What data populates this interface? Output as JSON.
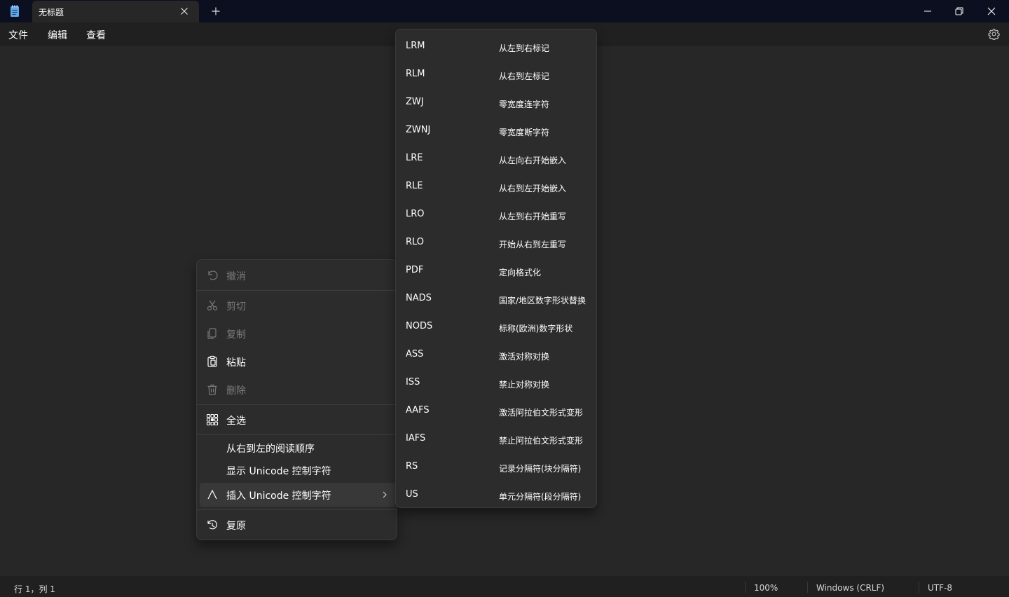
{
  "window": {
    "tab_title": "无标题"
  },
  "menubar": {
    "file": "文件",
    "edit": "编辑",
    "view": "查看"
  },
  "context_menu": {
    "undo": "撤消",
    "cut": "剪切",
    "copy": "复制",
    "paste": "粘贴",
    "delete": "删除",
    "select_all": "全选",
    "rtl_reading": "从右到左的阅读顺序",
    "show_unicode": "显示 Unicode 控制字符",
    "insert_unicode": "插入 Unicode 控制字符",
    "reconvert": "复原"
  },
  "submenu": [
    {
      "code": "LRM",
      "desc": "从左到右标记"
    },
    {
      "code": "RLM",
      "desc": "从右到左标记"
    },
    {
      "code": "ZWJ",
      "desc": "零宽度连字符"
    },
    {
      "code": "ZWNJ",
      "desc": "零宽度断字符"
    },
    {
      "code": "LRE",
      "desc": "从左向右开始嵌入"
    },
    {
      "code": "RLE",
      "desc": "从右到左开始嵌入"
    },
    {
      "code": "LRO",
      "desc": "从左到右开始重写"
    },
    {
      "code": "RLO",
      "desc": "开始从右到左重写"
    },
    {
      "code": "PDF",
      "desc": "定向格式化"
    },
    {
      "code": "NADS",
      "desc": "国家/地区数字形状替换"
    },
    {
      "code": "NODS",
      "desc": "标称(欧洲)数字形状"
    },
    {
      "code": "ASS",
      "desc": "激活对称对换"
    },
    {
      "code": "ISS",
      "desc": "禁止对称对换"
    },
    {
      "code": "AAFS",
      "desc": "激活阿拉伯文形式变形"
    },
    {
      "code": "IAFS",
      "desc": "禁止阿拉伯文形式变形"
    },
    {
      "code": "RS",
      "desc": "记录分隔符(块分隔符)"
    },
    {
      "code": "US",
      "desc": "单元分隔符(段分隔符)"
    }
  ],
  "statusbar": {
    "position": "行 1，列 1",
    "zoom": "100%",
    "line_ending": "Windows (CRLF)",
    "encoding": "UTF-8"
  },
  "colors": {
    "titlebar": "#0b0f1f",
    "editor_bg": "#272727",
    "menu_bg": "#2c2c2c",
    "accent_icon": "#5fa8e8"
  }
}
